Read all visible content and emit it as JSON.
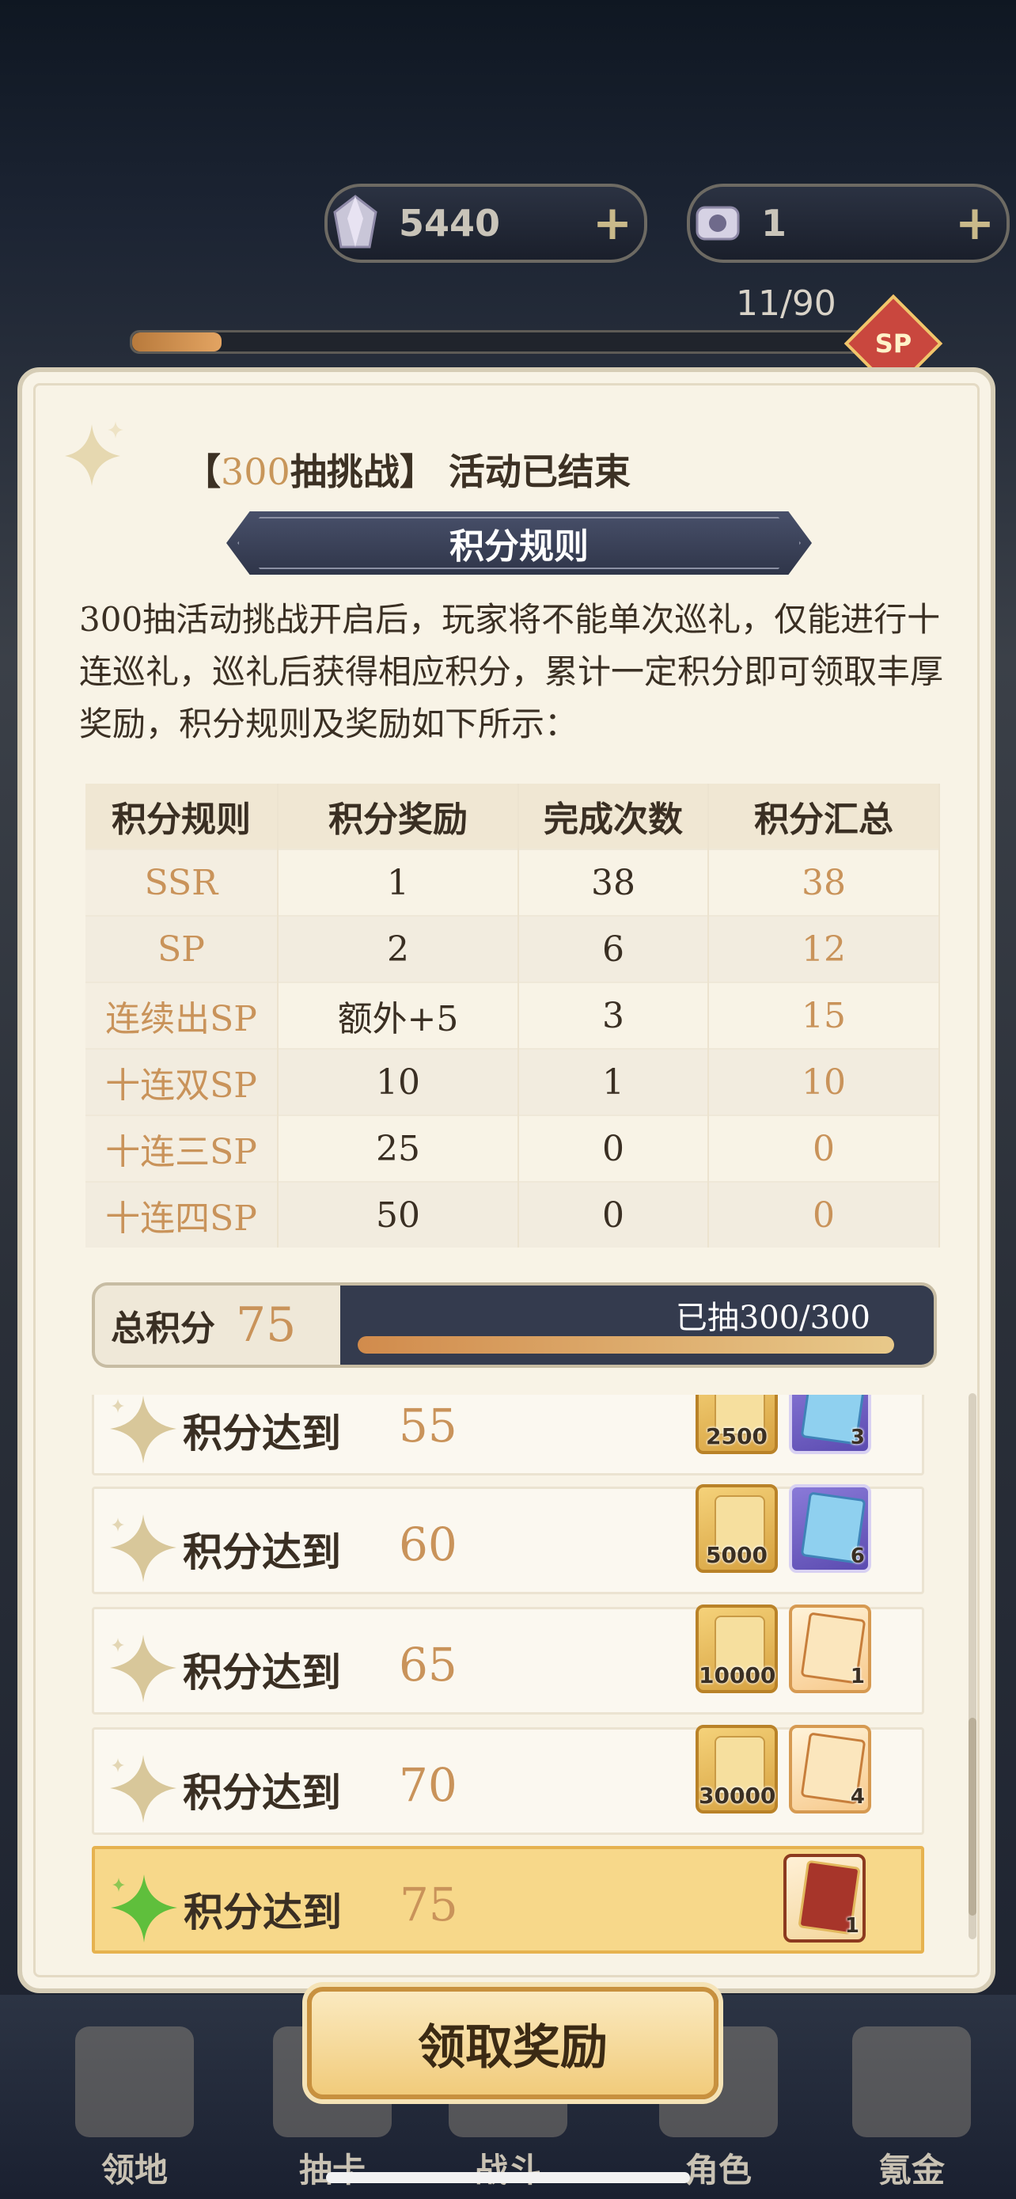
{
  "currency": {
    "left": {
      "icon": "crystal-icon",
      "value": "5440",
      "plus": "+"
    },
    "right": {
      "icon": "ticket-scroll-icon",
      "value": "1",
      "plus": "+"
    }
  },
  "pity": {
    "text": "11/90",
    "progress_fraction": 0.122,
    "badge": "SP"
  },
  "panel": {
    "title_open": "【",
    "title_num": "300",
    "title_rest": "抽挑战】 活动已结束",
    "rules_banner": "积分规则",
    "description": "300抽活动挑战开启后，玩家将不能单次巡礼，仅能进行十连巡礼，巡礼后获得相应积分，累计一定积分即可领取丰厚奖励，积分规则及奖励如下所示："
  },
  "table": {
    "headers": [
      "积分规则",
      "积分奖励",
      "完成次数",
      "积分汇总"
    ],
    "rows": [
      [
        "SSR",
        "1",
        "38",
        "38"
      ],
      [
        "SP",
        "2",
        "6",
        "12"
      ],
      [
        "连续出SP",
        "额外+5",
        "3",
        "15"
      ],
      [
        "十连双SP",
        "10",
        "1",
        "10"
      ],
      [
        "十连三SP",
        "25",
        "0",
        "0"
      ],
      [
        "十连四SP",
        "50",
        "0",
        "0"
      ]
    ]
  },
  "total": {
    "label": "总积分",
    "value": "75",
    "drawn": "已抽300/300",
    "progress_fraction": 1.0
  },
  "rewards": [
    {
      "label": "积分达到",
      "goal": "55",
      "items": [
        {
          "type": "gold",
          "qty": "2500"
        },
        {
          "type": "blue",
          "qty": "3"
        }
      ]
    },
    {
      "label": "积分达到",
      "goal": "60",
      "items": [
        {
          "type": "gold",
          "qty": "5000"
        },
        {
          "type": "blue",
          "qty": "6"
        }
      ]
    },
    {
      "label": "积分达到",
      "goal": "65",
      "items": [
        {
          "type": "gold",
          "qty": "10000"
        },
        {
          "type": "orange",
          "qty": "1"
        }
      ]
    },
    {
      "label": "积分达到",
      "goal": "70",
      "items": [
        {
          "type": "gold",
          "qty": "30000"
        },
        {
          "type": "orange",
          "qty": "4"
        }
      ]
    },
    {
      "label": "积分达到",
      "goal": "75",
      "items": [
        {
          "type": "red",
          "qty": "1"
        }
      ],
      "active": true
    }
  ],
  "claim_button": "领取奖励",
  "nav": [
    {
      "label": "领地",
      "icon": "castle-icon"
    },
    {
      "label": "抽卡",
      "icon": "cards-icon"
    },
    {
      "label": "战斗",
      "icon": "battle-icon"
    },
    {
      "label": "角色",
      "icon": "character-icon"
    },
    {
      "label": "氪金",
      "icon": "treasure-icon"
    }
  ],
  "colors": {
    "accent_gold": "#c9935a",
    "banner_navy": "#343b4e",
    "panel_bg": "#f8f3e6",
    "active_row": "#f7d88a"
  }
}
